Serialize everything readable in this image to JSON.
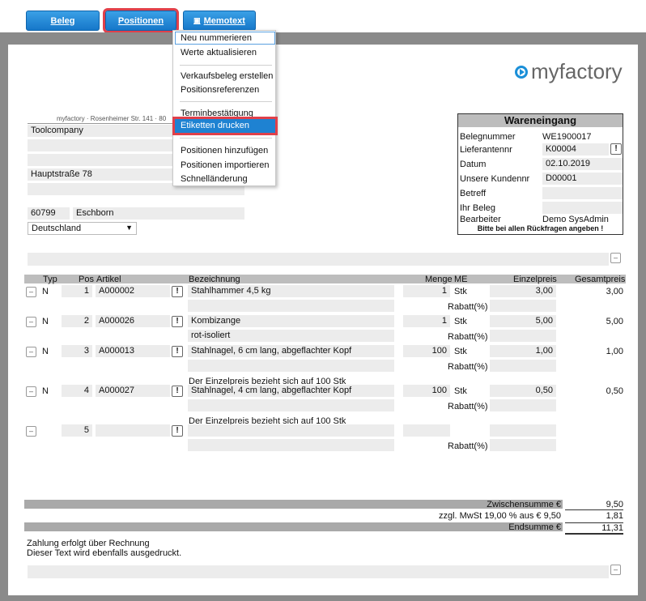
{
  "toolbar": {
    "beleg": "Beleg",
    "positionen": "Positionen",
    "memotext": "Memotext"
  },
  "menu": {
    "items": [
      "Neu nummerieren",
      "Werte aktualisieren",
      "Verkaufsbeleg erstellen",
      "Positionsreferenzen",
      "Terminbestätigung",
      "Etiketten drucken",
      "Positionen hinzufügen",
      "Positionen importieren",
      "Schnelländerung"
    ]
  },
  "logo": {
    "text": "myfactory",
    "color": "#1a8fd8"
  },
  "sender": "myfactory · Rosenheimer Str. 141 · 80",
  "address": {
    "company": "Toolcompany",
    "street": "Hauptstraße 78",
    "zip": "60799",
    "city": "Eschborn",
    "country": "Deutschland"
  },
  "doc": {
    "title": "Wareneingang",
    "labels": [
      "Belegnummer",
      "Lieferantennr",
      "Datum",
      "Unsere Kundennr",
      "Betreff",
      "Ihr Beleg",
      "Bearbeiter"
    ],
    "values": [
      "WE1900017",
      "K00004",
      "02.10.2019",
      "D00001",
      "",
      "",
      "Demo SysAdmin"
    ],
    "note": "Bitte bei allen Rückfragen angeben !"
  },
  "table": {
    "headers": [
      "Typ",
      "Pos",
      "Artikel",
      "Bezeichnung",
      "Menge",
      "ME",
      "Einzelpreis",
      "Gesamtpreis"
    ],
    "rabatt": "Rabatt(%)",
    "rows": [
      {
        "typ": "N",
        "pos": "1",
        "artikel": "A000002",
        "bez": "Stahlhammer 4,5 kg",
        "bez2": "",
        "menge": "1",
        "me": "Stk",
        "ep": "3,00",
        "gp": "3,00"
      },
      {
        "typ": "N",
        "pos": "2",
        "artikel": "A000026",
        "bez": "Kombizange",
        "bez2": "rot-isoliert",
        "menge": "1",
        "me": "Stk",
        "ep": "5,00",
        "gp": "5,00"
      },
      {
        "typ": "N",
        "pos": "3",
        "artikel": "A000013",
        "bez": "Stahlnagel, 6 cm lang, abgeflachter Kopf",
        "bez2": "",
        "menge": "100",
        "me": "Stk",
        "ep": "1,00",
        "gp": "1,00",
        "note": "Der Einzelpreis bezieht sich auf 100 Stk"
      },
      {
        "typ": "N",
        "pos": "4",
        "artikel": "A000027",
        "bez": "Stahlnagel, 4 cm lang, abgeflachter Kopf",
        "bez2": "",
        "menge": "100",
        "me": "Stk",
        "ep": "0,50",
        "gp": "0,50",
        "note": "Der Einzelpreis bezieht sich auf 100 Stk"
      },
      {
        "typ": "",
        "pos": "5",
        "artikel": "",
        "bez": "",
        "bez2": "",
        "menge": "",
        "me": "",
        "ep": "",
        "gp": ""
      }
    ]
  },
  "totals": {
    "zwischensumme_label": "Zwischensumme €",
    "zwischensumme": "9,50",
    "mwst_label": "zzgl. MwSt 19,00 % aus € 9,50",
    "mwst": "1,81",
    "endsumme_label": "Endsumme €",
    "endsumme": "11,31"
  },
  "footer": {
    "line1": "Zahlung erfolgt über Rechnung",
    "line2": "Dieser Text wird ebenfalls ausgedruckt."
  },
  "icons": {
    "dropdown": "▼",
    "minus": "–",
    "excl": "!"
  }
}
